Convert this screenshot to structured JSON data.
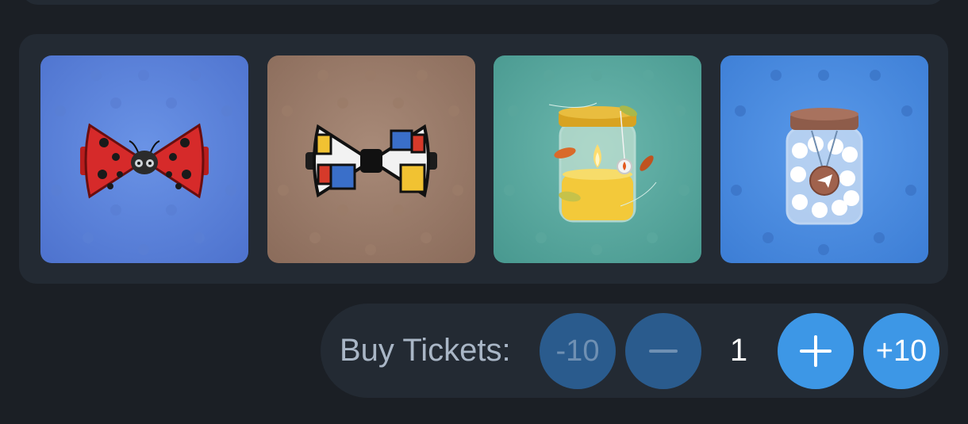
{
  "gifts": [
    {
      "name": "Ladybug bow tie",
      "bg": "#5b82d6"
    },
    {
      "name": "Mondrian bow tie",
      "bg": "#9a7a68"
    },
    {
      "name": "Candle jar",
      "bg": "#5ba9a0"
    },
    {
      "name": "Cotton jar",
      "bg": "#4f8de0"
    }
  ],
  "purchase": {
    "label": "Buy Tickets:",
    "minus_ten": "-10",
    "quantity": "1",
    "plus_ten": "+10"
  },
  "colors": {
    "background": "#1b1f25",
    "panel": "#232a33",
    "button_disabled": "#2a5b8d",
    "button_active": "#3d97e6"
  }
}
